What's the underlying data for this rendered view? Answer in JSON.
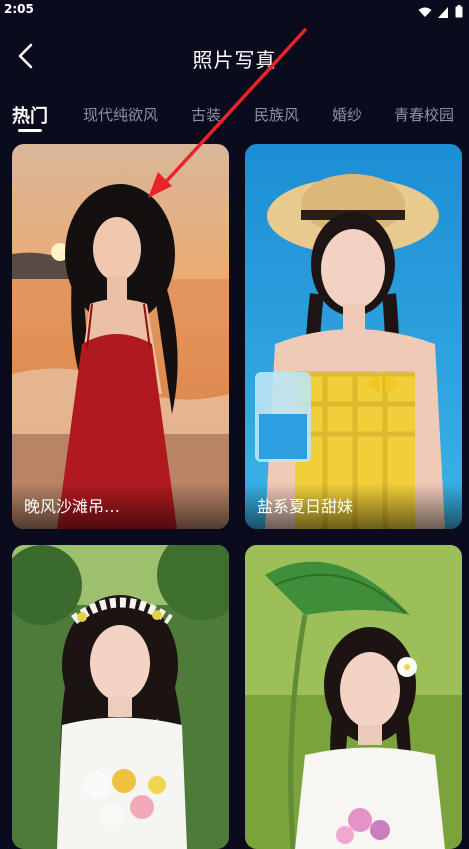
{
  "status_bar": {
    "time": "2:05"
  },
  "header": {
    "title": "照片写真"
  },
  "tabs": [
    {
      "label": "热门",
      "active": true
    },
    {
      "label": "现代纯欲风",
      "active": false
    },
    {
      "label": "古装",
      "active": false
    },
    {
      "label": "民族风",
      "active": false
    },
    {
      "label": "婚纱",
      "active": false
    },
    {
      "label": "青春校园",
      "active": false
    }
  ],
  "cards": [
    {
      "caption": "晚风沙滩吊…"
    },
    {
      "caption": "盐系夏日甜妹"
    },
    {
      "caption": ""
    },
    {
      "caption": ""
    }
  ],
  "colors": {
    "background": "#0b0b1e",
    "annotation_arrow": "#e8242a",
    "tab_inactive": "#8d90a8"
  }
}
